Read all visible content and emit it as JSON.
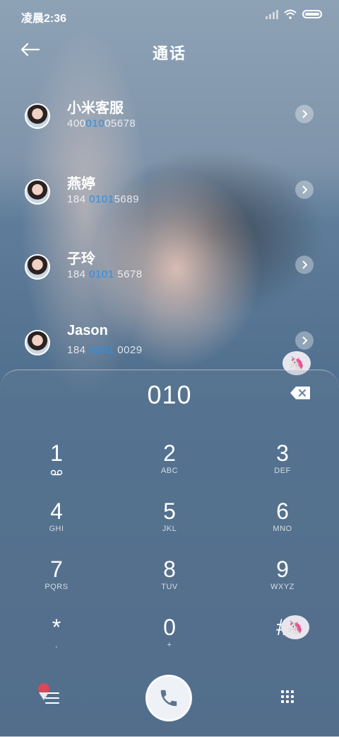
{
  "status": {
    "time": "凌晨2:36"
  },
  "header": {
    "title": "通话"
  },
  "contacts": [
    {
      "name": "小米客服",
      "num_pre": "400",
      "num_hl": "010",
      "num_post": "05678"
    },
    {
      "name": "燕婷",
      "num_pre": "184 ",
      "num_hl": "0101",
      "num_post": "5689"
    },
    {
      "name": "子玲",
      "num_pre": "184 ",
      "num_hl": "0101",
      "num_post": " 5678"
    },
    {
      "name": "Jason",
      "num_pre": "184 ",
      "num_hl": "0101",
      "num_post": " 0029"
    }
  ],
  "dialpad": {
    "dialed": "010",
    "keys": [
      {
        "digit": "1",
        "letters": ""
      },
      {
        "digit": "2",
        "letters": "ABC"
      },
      {
        "digit": "3",
        "letters": "DEF"
      },
      {
        "digit": "4",
        "letters": "GHI"
      },
      {
        "digit": "5",
        "letters": "JKL"
      },
      {
        "digit": "6",
        "letters": "MNO"
      },
      {
        "digit": "7",
        "letters": "PQRS"
      },
      {
        "digit": "8",
        "letters": "TUV"
      },
      {
        "digit": "9",
        "letters": "WXYZ"
      },
      {
        "digit": "*",
        "letters": ","
      },
      {
        "digit": "0",
        "letters": "+"
      },
      {
        "digit": "#",
        "letters": ""
      }
    ]
  },
  "colors": {
    "highlight": "#2f8fe0",
    "call_button": "#eef2f7",
    "call_icon": "#5d7390"
  },
  "icons": [
    "back-arrow-icon",
    "signal-icon",
    "wifi-icon",
    "battery-icon",
    "chevron-right-icon",
    "backspace-icon",
    "voicemail-icon",
    "menu-icon",
    "phone-icon",
    "dialpad-grid-icon"
  ]
}
